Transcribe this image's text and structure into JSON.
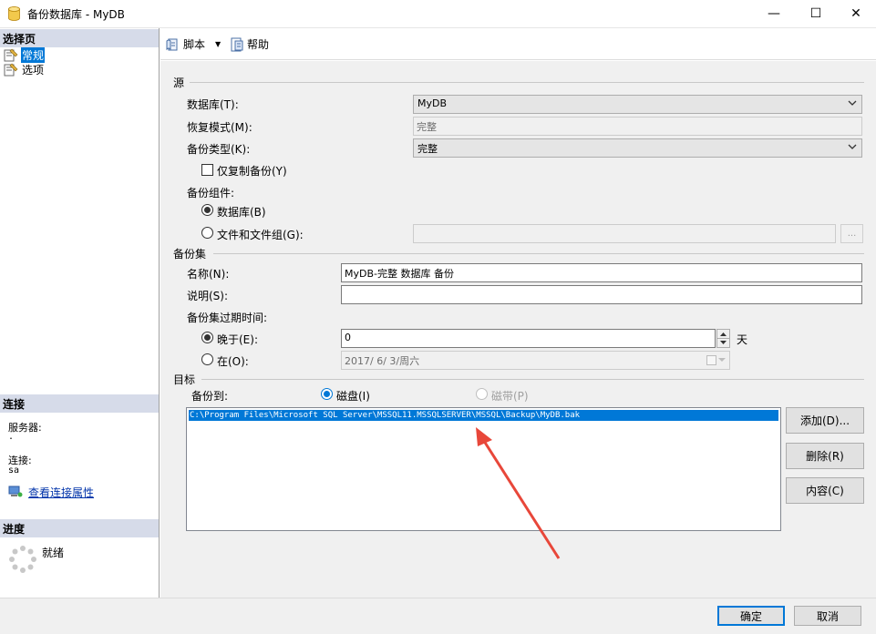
{
  "window": {
    "title": "备份数据库 - MyDB",
    "minimize": "—",
    "maximize": "☐",
    "close": "✕"
  },
  "left": {
    "select_page_header": "选择页",
    "pages": [
      {
        "label": "常规",
        "selected": true
      },
      {
        "label": "选项",
        "selected": false
      }
    ],
    "connection_header": "连接",
    "server_label": "服务器:",
    "server_value": ".",
    "connection_label": "连接:",
    "connection_value": "sa",
    "view_properties_link": "查看连接属性",
    "progress_header": "进度",
    "progress_status": "就绪"
  },
  "toolbar": {
    "script_label": "脚本",
    "script_arrow": "▼",
    "help_label": "帮助"
  },
  "source": {
    "section_label": "源",
    "database_label": "数据库(T):",
    "database_value": "MyDB",
    "recovery_label": "恢复模式(M):",
    "recovery_value": "完整",
    "backup_type_label": "备份类型(K):",
    "backup_type_value": "完整",
    "copy_only_label": "仅复制备份(Y)",
    "copy_only_checked": false,
    "component_label": "备份组件:",
    "component_database_label": "数据库(B)",
    "component_files_label": "文件和文件组(G):",
    "files_browse": "...",
    "component_selected": "database"
  },
  "backup_set": {
    "section_label": "备份集",
    "name_label": "名称(N):",
    "name_value": "MyDB-完整 数据库 备份",
    "description_label": "说明(S):",
    "description_value": "",
    "expire_label": "备份集过期时间:",
    "after_label": "晚于(E):",
    "after_value": "0",
    "after_unit": "天",
    "on_label": "在(O):",
    "on_value": "2017/ 6/ 3/周六",
    "expire_selected": "after"
  },
  "destination": {
    "section_label": "目标",
    "backup_to_label": "备份到:",
    "disk_label": "磁盘(I)",
    "tape_label": "磁带(P)",
    "selected": "disk",
    "paths": [
      "C:\\Program Files\\Microsoft SQL Server\\MSSQL11.MSSQLSERVER\\MSSQL\\Backup\\MyDB.bak"
    ],
    "add_button": "添加(D)...",
    "remove_button": "删除(R)",
    "contents_button": "内容(C)"
  },
  "footer": {
    "ok_button": "确定",
    "cancel_button": "取消"
  },
  "colors": {
    "accent": "#0078d7",
    "header_bg": "#d6dbe9",
    "annotation_arrow": "#e8473a"
  }
}
